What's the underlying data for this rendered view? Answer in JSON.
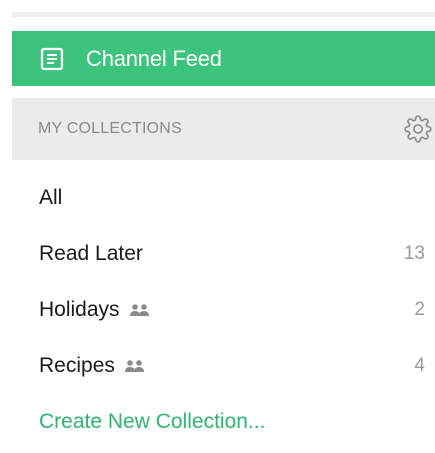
{
  "nav": {
    "channel_feed_label": "Channel Feed",
    "channel_feed_icon": "feed-icon"
  },
  "collections": {
    "header_title": "MY COLLECTIONS",
    "settings_icon": "gear-icon",
    "items": [
      {
        "name": "All",
        "count": "",
        "shared": false
      },
      {
        "name": "Read Later",
        "count": "13",
        "shared": false
      },
      {
        "name": "Holidays",
        "count": "2",
        "shared": true
      },
      {
        "name": "Recipes",
        "count": "4",
        "shared": true
      }
    ],
    "create_label": "Create New Collection..."
  },
  "colors": {
    "accent": "#3cc37c",
    "link": "#2fb36f",
    "header_bg": "#ebebeb"
  }
}
